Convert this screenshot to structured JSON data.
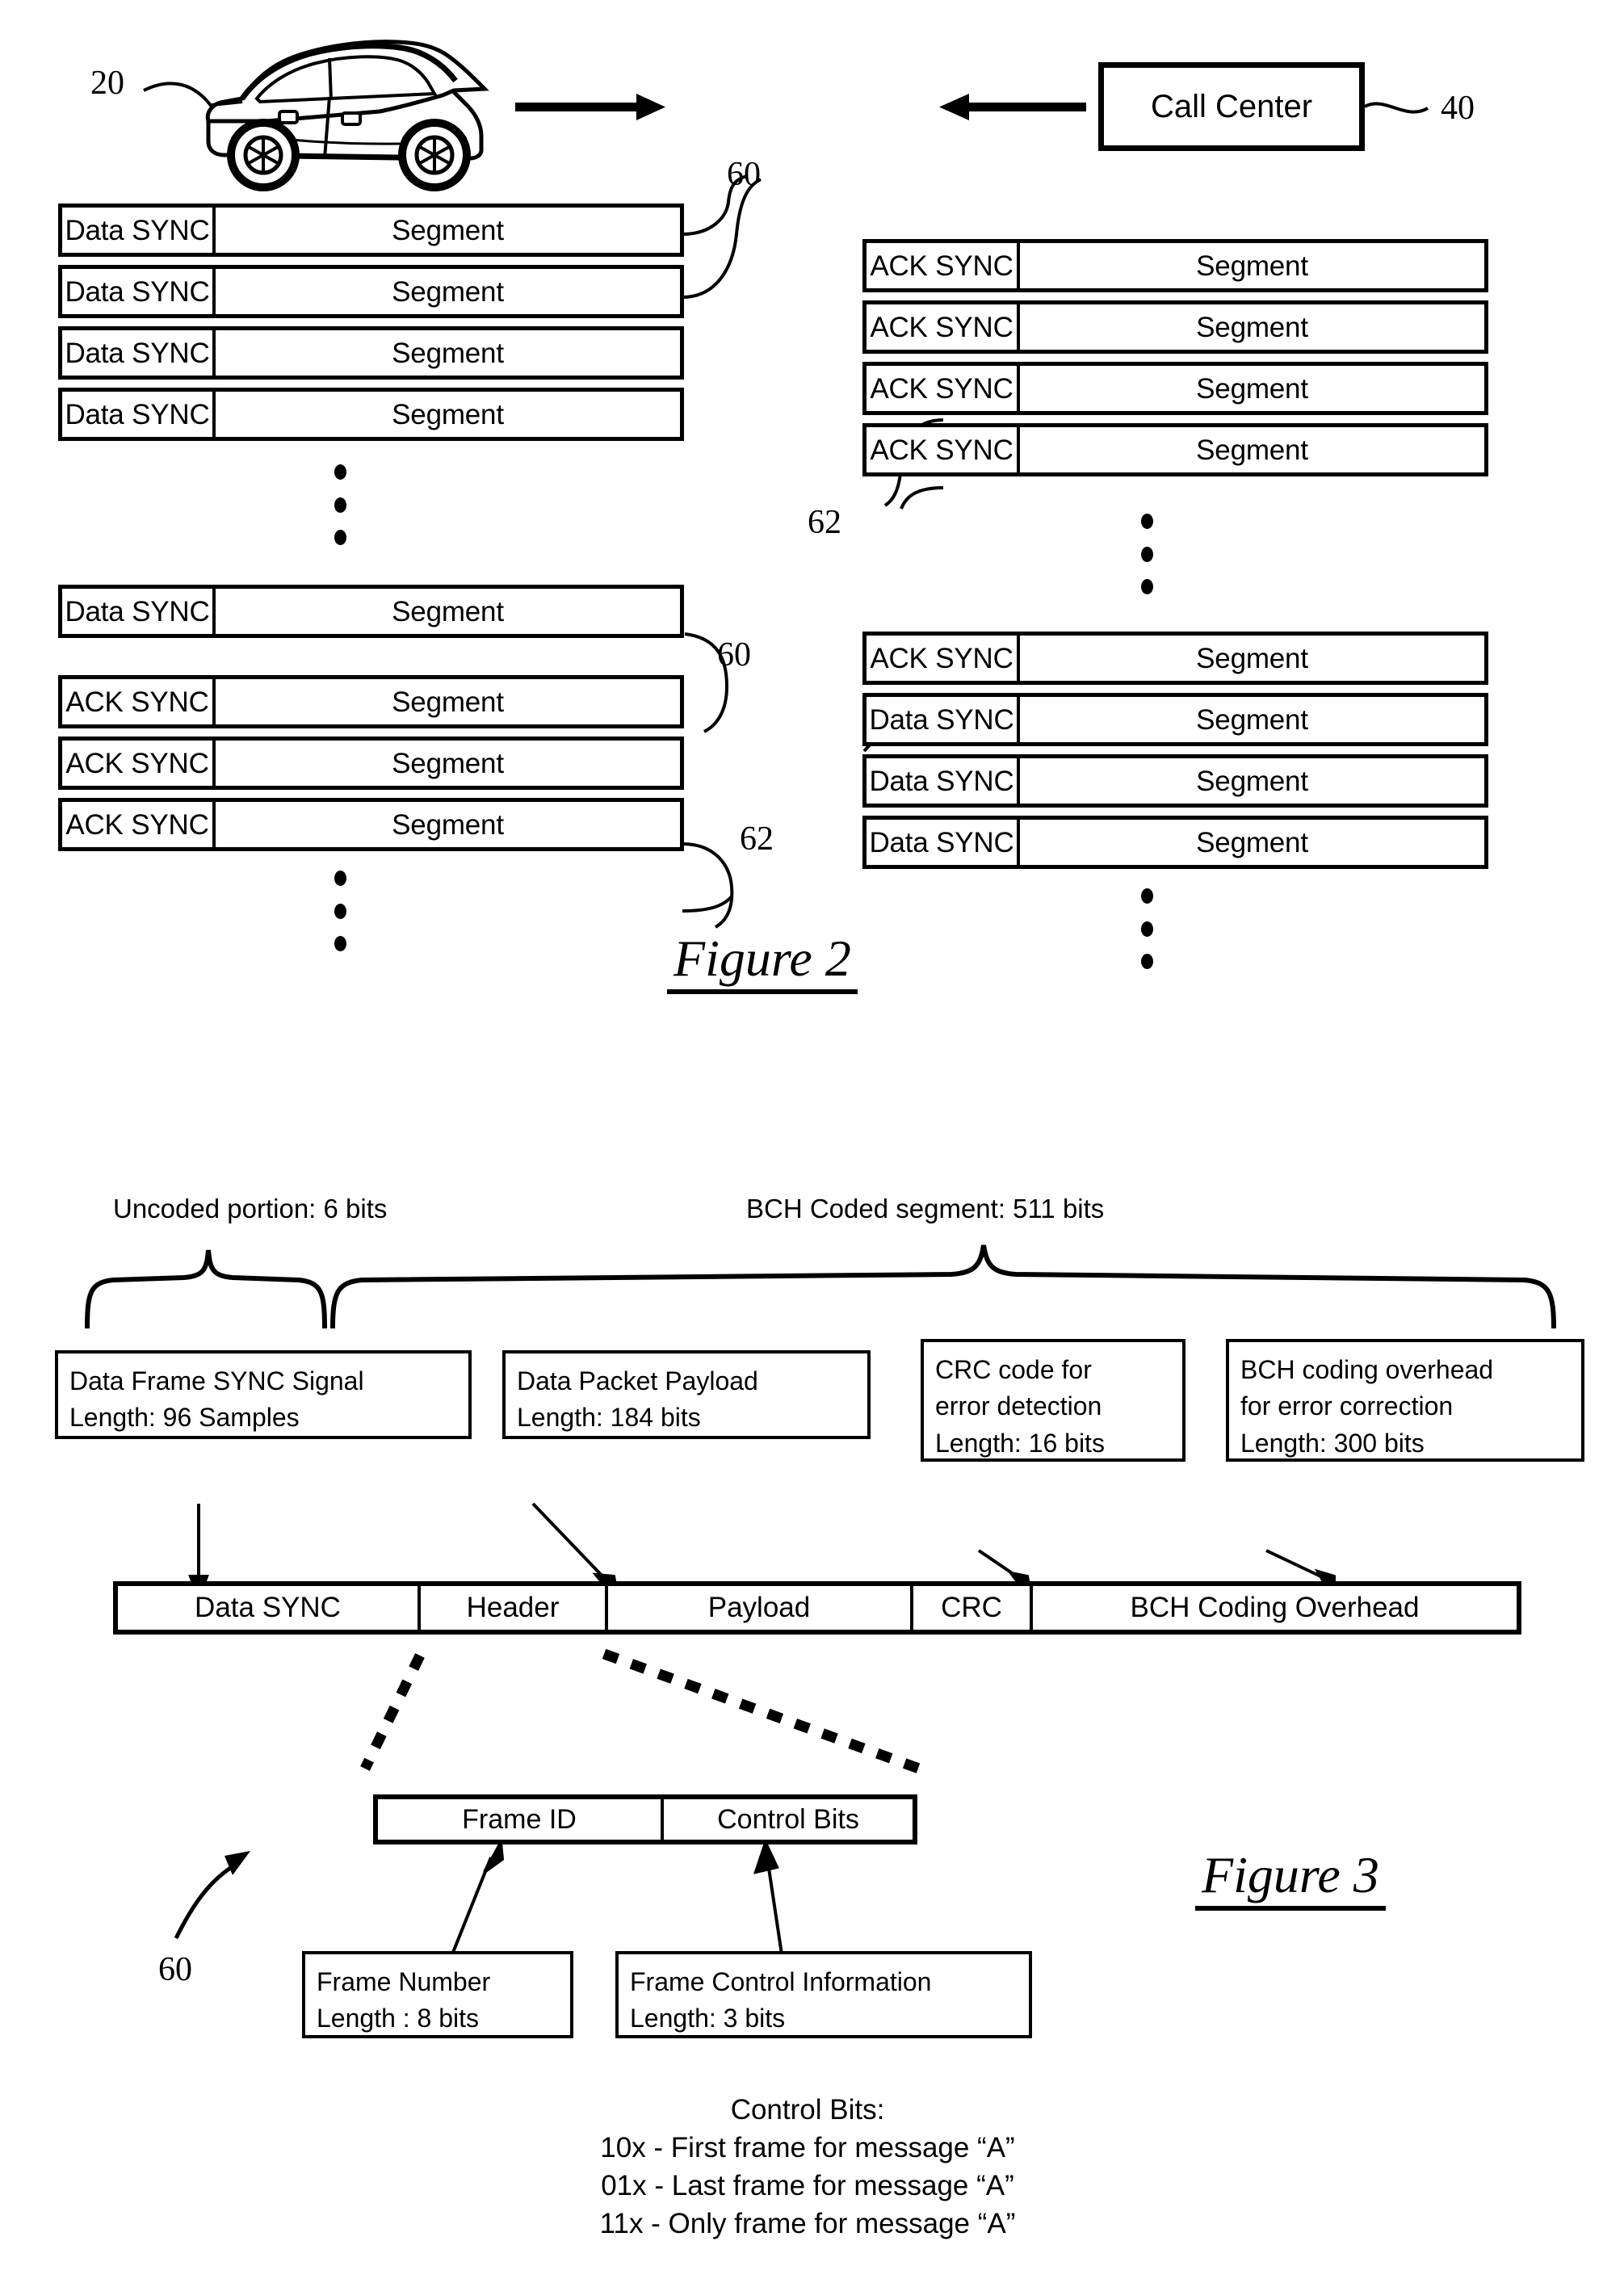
{
  "figure2": {
    "caption": "Figure 2",
    "vehicle_ref": "20",
    "call_center": {
      "label": "Call Center",
      "ref": "40"
    },
    "refs": {
      "data_frame": "60",
      "ack_frame": "62"
    },
    "left_column": {
      "group1": [
        {
          "sync": "Data SYNC",
          "segment": "Segment"
        },
        {
          "sync": "Data SYNC",
          "segment": "Segment"
        },
        {
          "sync": "Data SYNC",
          "segment": "Segment"
        },
        {
          "sync": "Data SYNC",
          "segment": "Segment"
        }
      ],
      "group2": [
        {
          "sync": "Data SYNC",
          "segment": "Segment"
        }
      ],
      "group3": [
        {
          "sync": "ACK SYNC",
          "segment": "Segment"
        },
        {
          "sync": "ACK SYNC",
          "segment": "Segment"
        },
        {
          "sync": "ACK SYNC",
          "segment": "Segment"
        }
      ]
    },
    "right_column": {
      "group1": [
        {
          "sync": "ACK SYNC",
          "segment": "Segment"
        },
        {
          "sync": "ACK SYNC",
          "segment": "Segment"
        },
        {
          "sync": "ACK SYNC",
          "segment": "Segment"
        },
        {
          "sync": "ACK SYNC",
          "segment": "Segment"
        }
      ],
      "group2": [
        {
          "sync": "ACK SYNC",
          "segment": "Segment"
        },
        {
          "sync": "Data SYNC",
          "segment": "Segment"
        },
        {
          "sync": "Data SYNC",
          "segment": "Segment"
        },
        {
          "sync": "Data SYNC",
          "segment": "Segment"
        }
      ]
    }
  },
  "figure3": {
    "caption": "Figure 3",
    "frame_ref": "60",
    "brace_labels": {
      "uncoded": "Uncoded portion: 6 bits",
      "bch": "BCH Coded segment: 511 bits"
    },
    "descriptions": [
      {
        "line1": "Data Frame SYNC Signal",
        "line2": "Length: 96 Samples"
      },
      {
        "line1": "Data Packet Payload",
        "line2": "Length: 184 bits"
      },
      {
        "line1": "CRC code for",
        "line2": "error detection",
        "line3": "Length: 16 bits"
      },
      {
        "line1": "BCH coding overhead",
        "line2": "for error correction",
        "line3": "Length: 300 bits"
      }
    ],
    "frame_bar": [
      {
        "label": "Data SYNC"
      },
      {
        "label": "Header"
      },
      {
        "label": "Payload"
      },
      {
        "label": "CRC"
      },
      {
        "label": "BCH Coding Overhead"
      }
    ],
    "header_bar": [
      {
        "label": "Frame ID"
      },
      {
        "label": "Control Bits"
      }
    ],
    "header_descriptions": [
      {
        "line1": "Frame Number",
        "line2": "Length : 8 bits"
      },
      {
        "line1": "Frame Control Information",
        "line2": "Length: 3 bits"
      }
    ],
    "control_bits_legend": {
      "title": "Control Bits:",
      "lines": [
        "10x - First frame for message “A”",
        "01x - Last frame for message “A”",
        "11x - Only frame for message “A”"
      ]
    }
  }
}
